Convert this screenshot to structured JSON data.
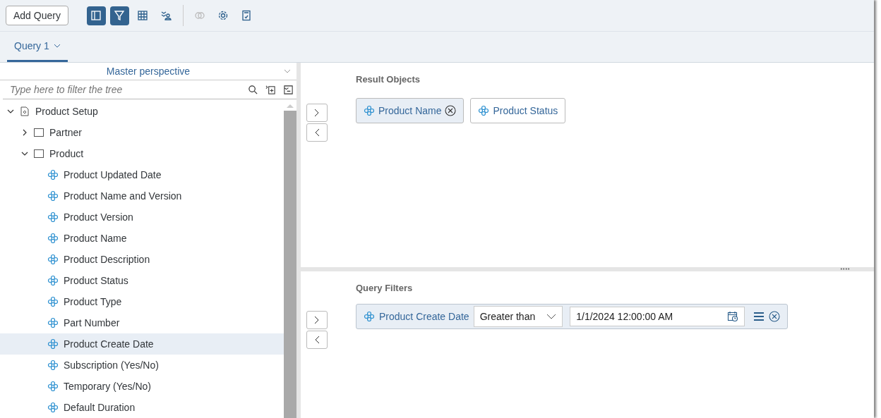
{
  "toolbar": {
    "add_button": "Add Query",
    "tools": [
      {
        "selected": true,
        "disabled": false
      },
      {
        "selected": true,
        "disabled": false
      },
      {
        "selected": false,
        "disabled": false
      },
      {
        "selected": false,
        "disabled": false
      },
      {
        "selected": false,
        "disabled": true
      },
      {
        "selected": false,
        "disabled": false
      },
      {
        "selected": false,
        "disabled": false
      }
    ]
  },
  "tabs": [
    {
      "label": "Query 1",
      "selected": true
    }
  ],
  "tree_panel": {
    "perspective": "Master perspective",
    "filter": {
      "placeholder": "Type here to filter the tree"
    },
    "tree": [
      {
        "label": "Product Setup",
        "kind": "universe",
        "expanded": true,
        "selected": false,
        "children": [
          {
            "label": "Partner",
            "kind": "folder",
            "expanded": false,
            "selected": false
          },
          {
            "label": "Product",
            "kind": "folder",
            "expanded": true,
            "selected": false,
            "children": [
              {
                "label": "Product Updated Date",
                "kind": "dimension",
                "selected": false
              },
              {
                "label": "Product Name and Version",
                "kind": "dimension",
                "selected": false
              },
              {
                "label": "Product Version",
                "kind": "dimension",
                "selected": false
              },
              {
                "label": "Product Name",
                "kind": "dimension",
                "selected": false
              },
              {
                "label": "Product Description",
                "kind": "dimension",
                "selected": false
              },
              {
                "label": "Product Status",
                "kind": "dimension",
                "selected": false
              },
              {
                "label": "Product Type",
                "kind": "dimension",
                "selected": false
              },
              {
                "label": "Part Number",
                "kind": "dimension",
                "selected": false
              },
              {
                "label": "Product Create Date",
                "kind": "dimension",
                "selected": true
              },
              {
                "label": "Subscription (Yes/No)",
                "kind": "dimension",
                "selected": false
              },
              {
                "label": "Temporary (Yes/No)",
                "kind": "dimension",
                "selected": false
              },
              {
                "label": "Default Duration",
                "kind": "dimension",
                "selected": false
              }
            ]
          }
        ]
      }
    ]
  },
  "result_objects": {
    "title": "Result Objects",
    "items": [
      {
        "label": "Product Name",
        "selected": true
      },
      {
        "label": "Product Status",
        "selected": false
      }
    ]
  },
  "query_filters": {
    "title": "Query Filters",
    "filters": [
      {
        "object": "Product Create Date",
        "operator": "Greater than",
        "value": "1/1/2024 12:00:00 AM"
      }
    ]
  }
}
